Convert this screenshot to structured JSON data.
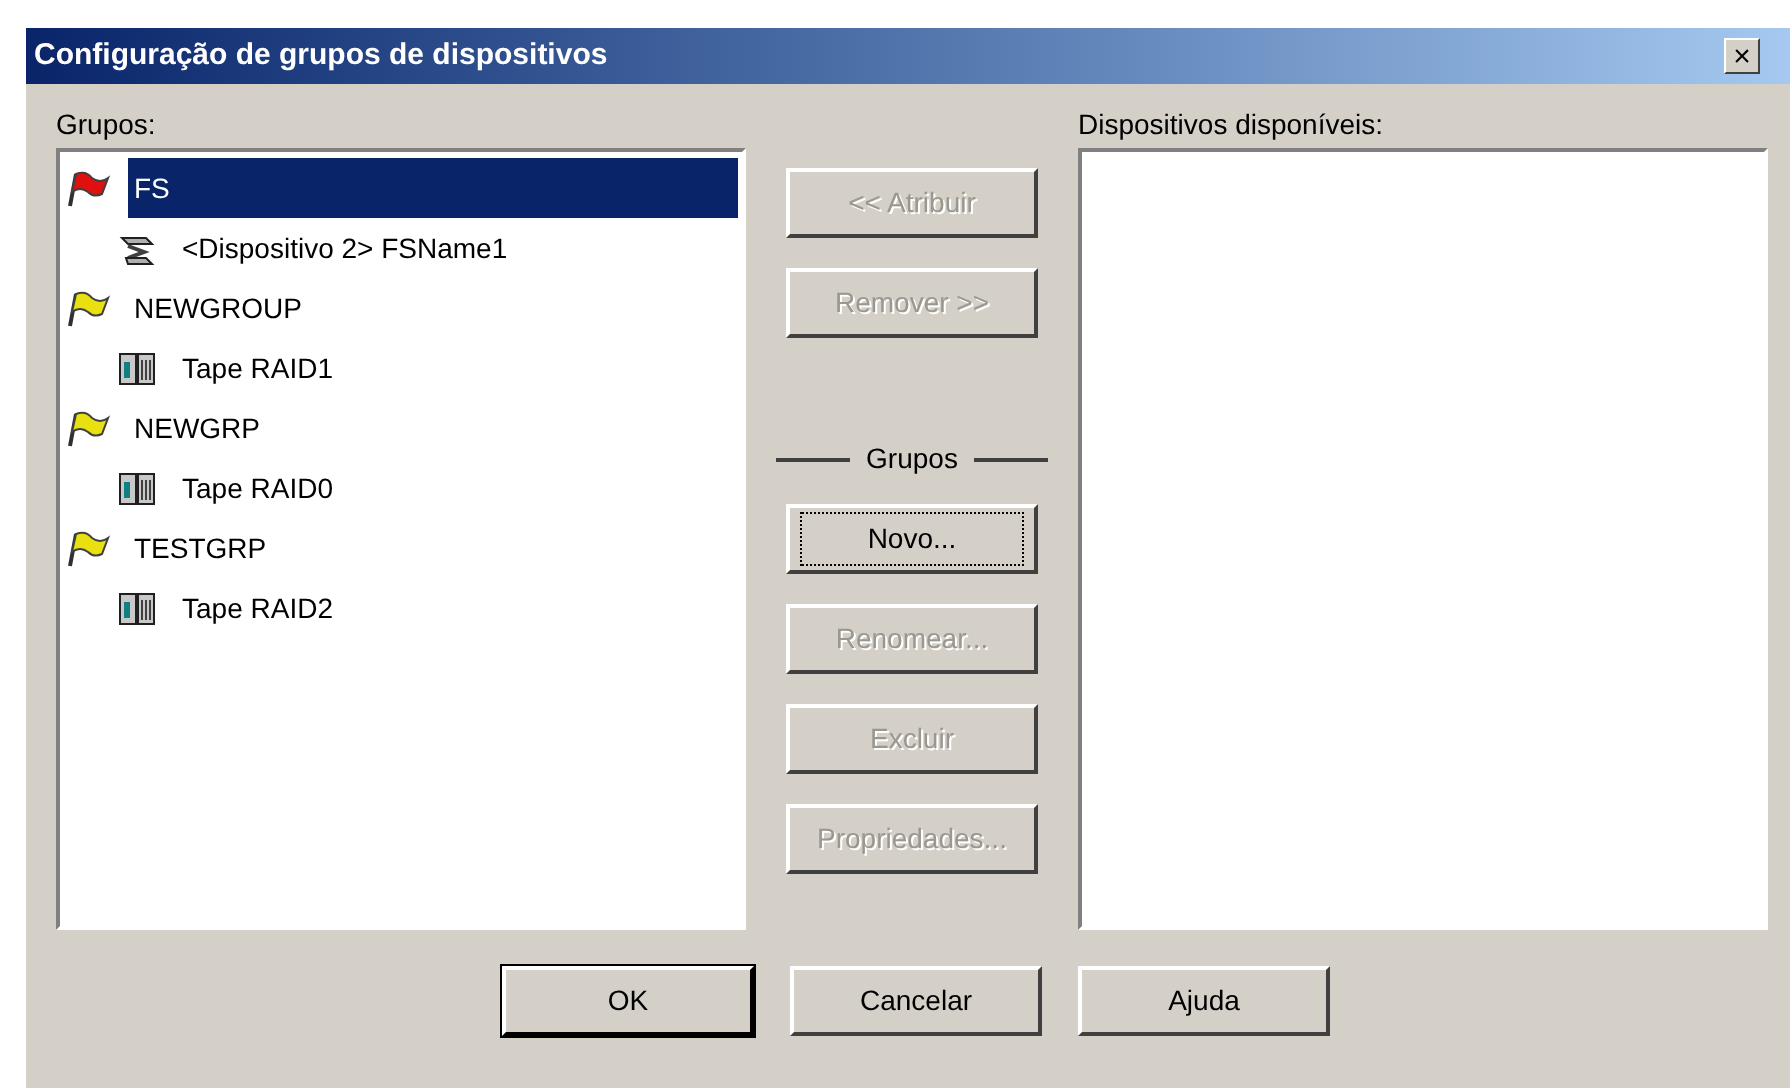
{
  "window": {
    "title": "Configuração de grupos de dispositivos",
    "close": "×"
  },
  "groups_label": "Grupos:",
  "groups": [
    {
      "name": "FS",
      "color": "#e01010",
      "selected": true,
      "children": [
        {
          "name": "<Dispositivo  2> FSName1",
          "kind": "network",
          "selected": false
        }
      ]
    },
    {
      "name": "NEWGROUP",
      "color": "#e8e010",
      "selected": false,
      "children": [
        {
          "name": "Tape RAID1",
          "kind": "tape",
          "selected": false
        }
      ]
    },
    {
      "name": "NEWGRP",
      "color": "#e8e010",
      "selected": false,
      "children": [
        {
          "name": "Tape RAID0",
          "kind": "tape",
          "selected": false
        }
      ]
    },
    {
      "name": "TESTGRP",
      "color": "#e8e010",
      "selected": false,
      "children": [
        {
          "name": "Tape RAID2",
          "kind": "tape",
          "selected": false
        }
      ]
    }
  ],
  "assign_buttons": [
    {
      "label": "<< Atribuir",
      "disabled": true,
      "focused": false
    },
    {
      "label": "Remover >>",
      "disabled": true,
      "focused": false
    }
  ],
  "group_section": {
    "title": "Grupos",
    "buttons": [
      {
        "label": "Novo...",
        "disabled": false,
        "focused": true
      },
      {
        "label": "Renomear...",
        "disabled": true,
        "focused": false
      },
      {
        "label": "Excluir",
        "disabled": true,
        "focused": false
      },
      {
        "label": "Propriedades...",
        "disabled": true,
        "focused": false
      }
    ]
  },
  "available_label": "Dispositivos disponíveis:",
  "footer_buttons": [
    {
      "label": "OK",
      "disabled": false,
      "focused": false,
      "default": true
    },
    {
      "label": "Cancelar",
      "disabled": false,
      "focused": false,
      "default": false
    },
    {
      "label": "Ajuda",
      "disabled": false,
      "focused": false,
      "default": false
    }
  ]
}
